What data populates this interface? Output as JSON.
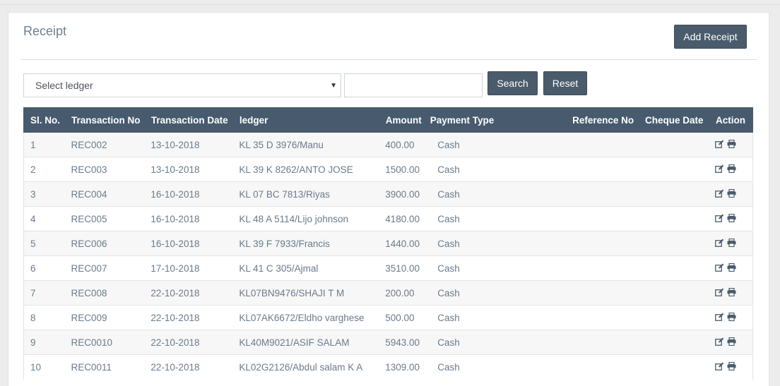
{
  "page": {
    "title": "Receipt",
    "add_button": "Add Receipt"
  },
  "filters": {
    "ledger_select": "Select ledger",
    "search_value": "",
    "search_button": "Search",
    "reset_button": "Reset"
  },
  "table": {
    "headers": {
      "sl_no": "Sl. No.",
      "transaction_no": "Transaction No",
      "transaction_date": "Transaction Date",
      "ledger": "ledger",
      "amount": "Amount",
      "payment_type": "Payment Type",
      "reference_no": "Reference No",
      "cheque_date": "Cheque Date",
      "action": "Action"
    },
    "rows": [
      {
        "sl": "1",
        "tno": "REC002",
        "date": "13-10-2018",
        "ledger": "KL 35 D 3976/Manu",
        "amount": "400.00",
        "ptype": "Cash",
        "ref": "",
        "cdate": ""
      },
      {
        "sl": "2",
        "tno": "REC003",
        "date": "13-10-2018",
        "ledger": "KL 39 K 8262/ANTO JOSE",
        "amount": "1500.00",
        "ptype": "Cash",
        "ref": "",
        "cdate": ""
      },
      {
        "sl": "3",
        "tno": "REC004",
        "date": "16-10-2018",
        "ledger": "KL 07 BC 7813/Riyas",
        "amount": "3900.00",
        "ptype": "Cash",
        "ref": "",
        "cdate": ""
      },
      {
        "sl": "4",
        "tno": "REC005",
        "date": "16-10-2018",
        "ledger": "KL 48 A 5114/Lijo johnson",
        "amount": "4180.00",
        "ptype": "Cash",
        "ref": "",
        "cdate": ""
      },
      {
        "sl": "5",
        "tno": "REC006",
        "date": "16-10-2018",
        "ledger": "KL 39 F 7933/Francis",
        "amount": "1440.00",
        "ptype": "Cash",
        "ref": "",
        "cdate": ""
      },
      {
        "sl": "6",
        "tno": "REC007",
        "date": "17-10-2018",
        "ledger": "KL 41 C 305/Ajmal",
        "amount": "3510.00",
        "ptype": "Cash",
        "ref": "",
        "cdate": ""
      },
      {
        "sl": "7",
        "tno": "REC008",
        "date": "22-10-2018",
        "ledger": "KL07BN9476/SHAJI T M",
        "amount": "200.00",
        "ptype": "Cash",
        "ref": "",
        "cdate": ""
      },
      {
        "sl": "8",
        "tno": "REC009",
        "date": "22-10-2018",
        "ledger": "KL07AK6672/Eldho varghese",
        "amount": "500.00",
        "ptype": "Cash",
        "ref": "",
        "cdate": ""
      },
      {
        "sl": "9",
        "tno": "REC0010",
        "date": "22-10-2018",
        "ledger": "KL40M9021/ASIF SALAM",
        "amount": "5943.00",
        "ptype": "Cash",
        "ref": "",
        "cdate": ""
      },
      {
        "sl": "10",
        "tno": "REC0011",
        "date": "22-10-2018",
        "ledger": "KL02G2126/Abdul salam K A",
        "amount": "1309.00",
        "ptype": "Cash",
        "ref": "",
        "cdate": ""
      }
    ],
    "action_icons": [
      "edit-icon",
      "print-icon"
    ]
  },
  "colors": {
    "header_bg": "#475a6e",
    "button_bg": "#4a5b6c"
  }
}
